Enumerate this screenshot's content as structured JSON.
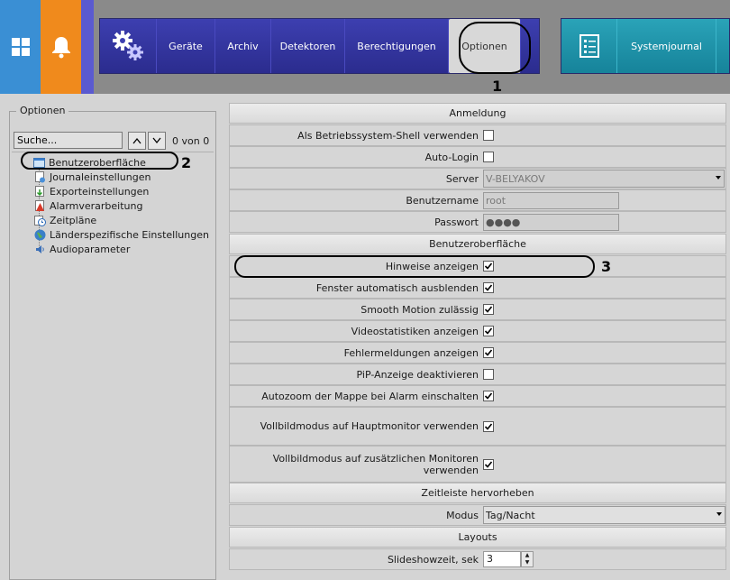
{
  "nav": {
    "items": [
      "Geräte",
      "Archiv",
      "Detektoren",
      "Berechtigungen",
      "Optionen"
    ],
    "systemjournal": "Systemjournal"
  },
  "callouts": {
    "n1": "1",
    "n2": "2",
    "n3": "3"
  },
  "left": {
    "title": "Optionen",
    "search_value": "Suche...",
    "count": "0 von 0",
    "tree": [
      {
        "label": "Benutzeroberfläche",
        "icon": "window-icon"
      },
      {
        "label": "Journaleinstellungen",
        "icon": "journal-settings-icon"
      },
      {
        "label": "Exporteinstellungen",
        "icon": "export-icon"
      },
      {
        "label": "Alarmverarbeitung",
        "icon": "alarm-icon"
      },
      {
        "label": "Zeitpläne",
        "icon": "schedule-icon"
      },
      {
        "label": "Länderspezifische Einstellungen",
        "icon": "globe-icon"
      },
      {
        "label": "Audioparameter",
        "icon": "audio-icon"
      }
    ]
  },
  "sections": {
    "anmeldung": "Anmeldung",
    "ui": "Benutzeroberfläche",
    "timeline": "Zeitleiste hervorheben",
    "layouts": "Layouts"
  },
  "fields": {
    "shell": {
      "label": "Als Betriebssystem-Shell verwenden",
      "checked": false
    },
    "autologin": {
      "label": "Auto-Login",
      "checked": false
    },
    "server": {
      "label": "Server",
      "value": "V-BELYAKOV"
    },
    "username": {
      "label": "Benutzername",
      "value": "root"
    },
    "password": {
      "label": "Passwort",
      "value": "●●●●"
    },
    "hints": {
      "label": "Hinweise anzeigen",
      "checked": true
    },
    "autohide": {
      "label": "Fenster automatisch ausblenden",
      "checked": true
    },
    "smooth": {
      "label": "Smooth Motion zulässig",
      "checked": true
    },
    "videostats": {
      "label": "Videostatistiken anzeigen",
      "checked": true
    },
    "errors": {
      "label": "Fehlermeldungen anzeigen",
      "checked": true
    },
    "pip": {
      "label": "PiP-Anzeige deaktivieren",
      "checked": false
    },
    "autozoom": {
      "label": "Autozoom der Mappe bei Alarm einschalten",
      "checked": true
    },
    "fullscreen_main": {
      "label": "Vollbildmodus auf Hauptmonitor verwenden",
      "checked": true
    },
    "fullscreen_extra": {
      "label": "Vollbildmodus auf zusätzlichen Monitoren verwenden",
      "checked": true
    },
    "modus": {
      "label": "Modus",
      "value": "Tag/Nacht"
    },
    "slideshow": {
      "label": "Slideshowzeit, sek",
      "value": "3"
    }
  }
}
